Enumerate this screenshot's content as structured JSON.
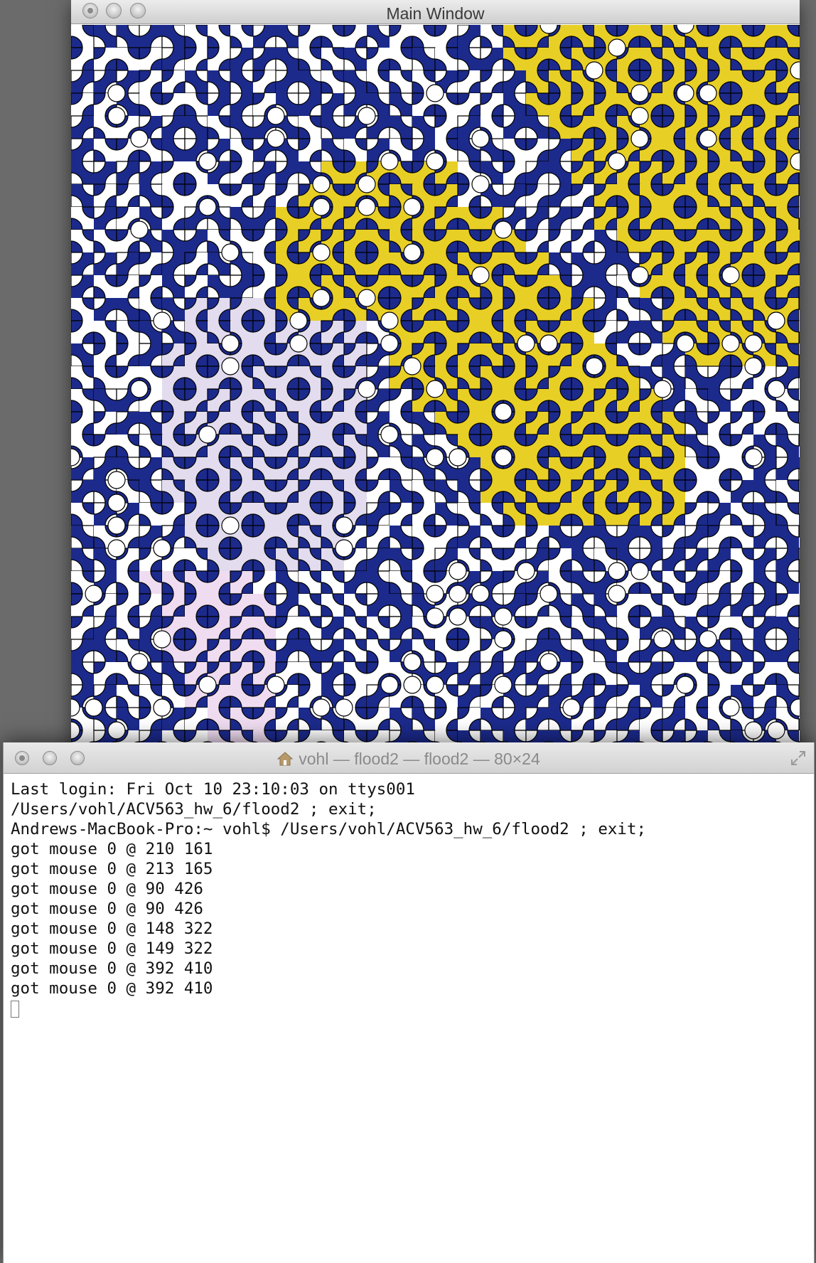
{
  "main_window": {
    "title": "Main Window",
    "controls": [
      "close-button",
      "minimize-button",
      "zoom-button"
    ],
    "canvas": {
      "description_icon": "truchet-flood-fill-canvas",
      "colors": {
        "blue": "#1c2a8c",
        "yellow": "#e8cf26",
        "lavender": "#e3dcee",
        "pink": "#efdcf0",
        "white": "#ffffff",
        "outline": "#000000"
      }
    }
  },
  "terminal_window": {
    "title": "vohl — flood2 — flood2 — 80×24",
    "lines": [
      "Last login: Fri Oct 10 23:10:03 on ttys001",
      "/Users/vohl/ACV563_hw_6/flood2 ; exit;",
      "Andrews-MacBook-Pro:~ vohl$ /Users/vohl/ACV563_hw_6/flood2 ; exit;",
      "got mouse 0 @ 210 161",
      "got mouse 0 @ 213 165",
      "got mouse 0 @ 90 426",
      "got mouse 0 @ 90 426",
      "got mouse 0 @ 148 322",
      "got mouse 0 @ 149 322",
      "got mouse 0 @ 392 410",
      "got mouse 0 @ 392 410"
    ]
  }
}
